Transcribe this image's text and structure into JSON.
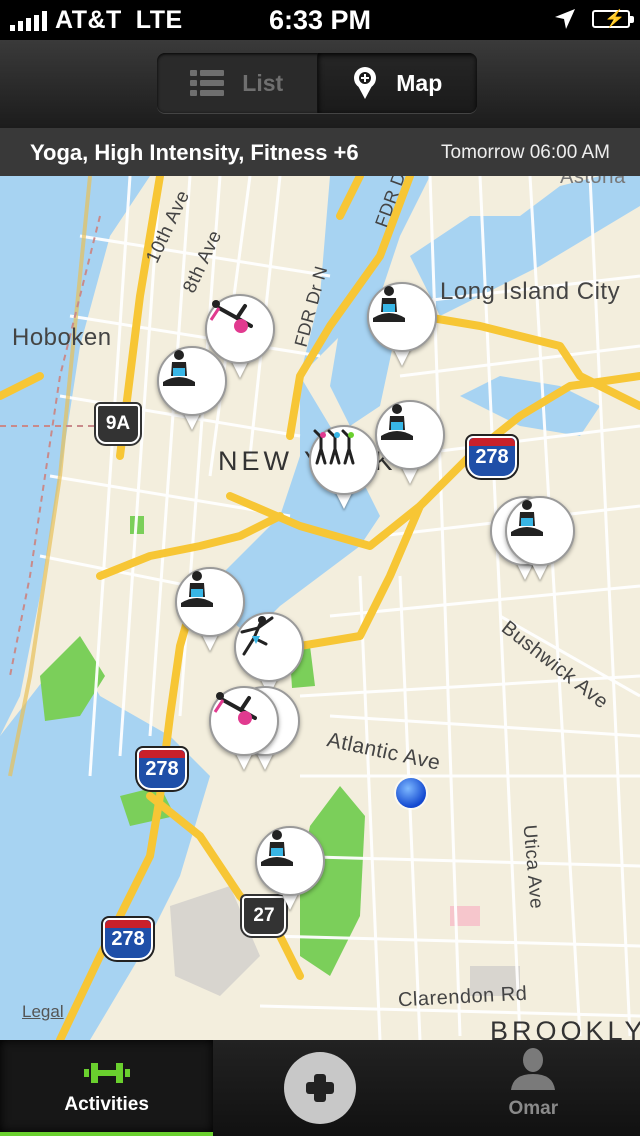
{
  "status_bar": {
    "carrier": "AT&T",
    "network": "LTE",
    "time": "6:33 PM"
  },
  "nav": {
    "segments": [
      {
        "label": "List",
        "selected": false,
        "icon": "list-icon"
      },
      {
        "label": "Map",
        "selected": true,
        "icon": "map-pin-icon"
      }
    ]
  },
  "filter": {
    "activities": "Yoga, High Intensity, Fitness +6",
    "when": "Tomorrow 06:00 AM"
  },
  "map": {
    "place_labels": [
      "Hoboken",
      "Long Island City",
      "NEW YORK",
      "Astoria",
      "BROOKLYN"
    ],
    "street_labels": [
      "10th Ave",
      "8th Ave",
      "FDR Dr N",
      "FDR Dr",
      "Atlantic Ave",
      "Bushwick Ave",
      "Utica Ave",
      "Clarendon Rd"
    ],
    "shields": [
      "9A",
      "278",
      "278",
      "278",
      "27"
    ],
    "legal": "Legal",
    "pins": [
      {
        "icon": "yoga-stretch-icon"
      },
      {
        "icon": "meditation-icon"
      },
      {
        "icon": "meditation-icon"
      },
      {
        "icon": "meditation-icon"
      },
      {
        "icon": "group-fitness-icon"
      },
      {
        "icon": "meditation-icon"
      },
      {
        "icon": "meditation-icon"
      },
      {
        "icon": "dance-icon"
      },
      {
        "icon": "yoga-stretch-icon"
      },
      {
        "icon": "meditation-icon"
      }
    ]
  },
  "tabbar": {
    "tabs": [
      {
        "label": "Activities",
        "icon": "dumbbell-icon",
        "active": true
      },
      {
        "label": "",
        "icon": "plus-icon",
        "active": false
      },
      {
        "label": "Omar",
        "icon": "user-icon",
        "active": false
      }
    ]
  },
  "colors": {
    "accent": "#6ad02e",
    "water": "#a7d3f2",
    "highway": "#f7c635",
    "park": "#7bcf5a"
  }
}
